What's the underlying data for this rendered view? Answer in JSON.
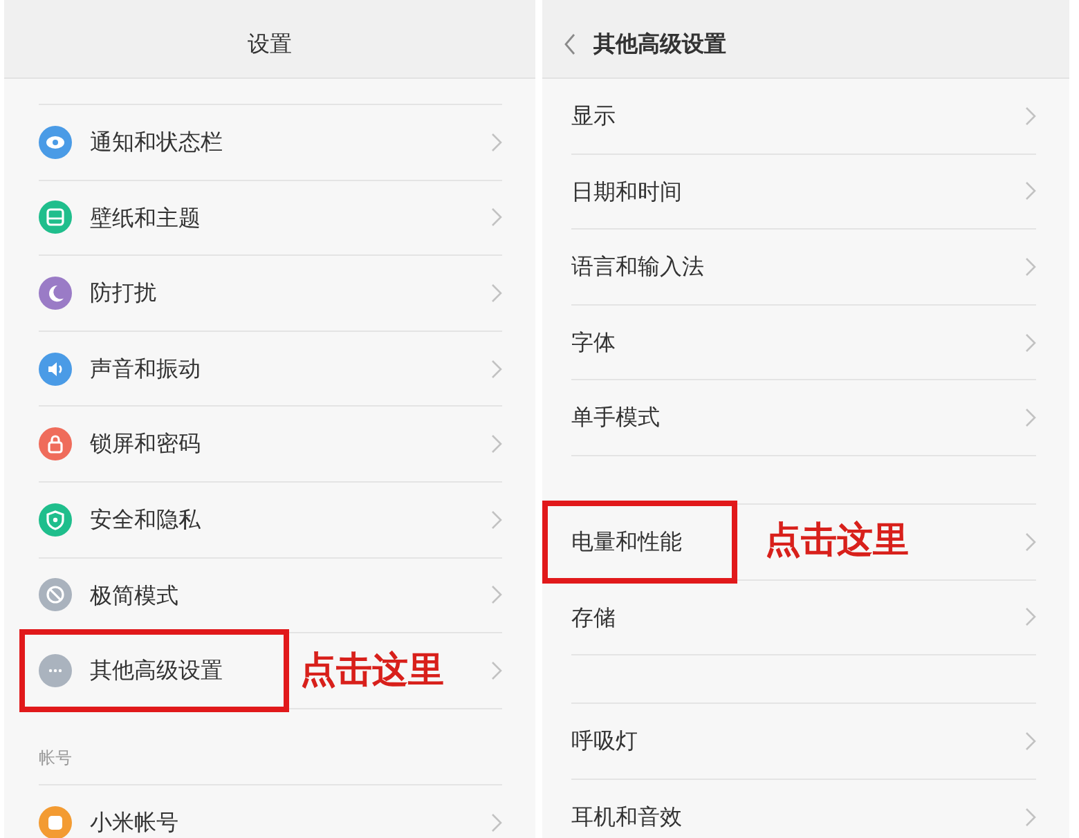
{
  "left_panel": {
    "kind": "main",
    "title": "设置",
    "sections": [
      {
        "items": [
          {
            "label": "通知和状态栏",
            "color": "#4a9be6",
            "highlighted": false
          },
          {
            "label": "壁纸和主题",
            "color": "#1fbe8c",
            "highlighted": false
          },
          {
            "label": "防打扰",
            "color": "#9a7bc6",
            "highlighted": false
          },
          {
            "label": "声音和振动",
            "color": "#4a9be6",
            "highlighted": false
          },
          {
            "label": "锁屏和密码",
            "color": "#ef6c5b",
            "highlighted": false
          },
          {
            "label": "安全和隐私",
            "color": "#1fbe8c",
            "highlighted": false
          },
          {
            "label": "极简模式",
            "color": "#a9b2bd",
            "highlighted": false
          },
          {
            "label": "其他高级设置",
            "color": "#aab3be",
            "highlighted": true,
            "callout": "点击这里"
          }
        ]
      },
      {
        "label": "帐号",
        "items": [
          {
            "label": "小米帐号",
            "color": "#f39b32",
            "highlighted": false
          }
        ]
      }
    ]
  },
  "right_panel": {
    "kind": "sub",
    "title": "其他高级设置",
    "sections": [
      {
        "items": [
          {
            "label": "显示",
            "highlighted": false
          },
          {
            "label": "日期和时间",
            "highlighted": false
          },
          {
            "label": "语言和输入法",
            "highlighted": false
          },
          {
            "label": "字体",
            "highlighted": false
          },
          {
            "label": "单手模式",
            "highlighted": false
          }
        ]
      },
      {
        "items": [
          {
            "label": "电量和性能",
            "highlighted": true,
            "callout": "点击这里"
          },
          {
            "label": "存储",
            "highlighted": false
          }
        ]
      },
      {
        "items": [
          {
            "label": "呼吸灯",
            "highlighted": false
          },
          {
            "label": "耳机和音效",
            "highlighted": false
          }
        ]
      }
    ]
  }
}
